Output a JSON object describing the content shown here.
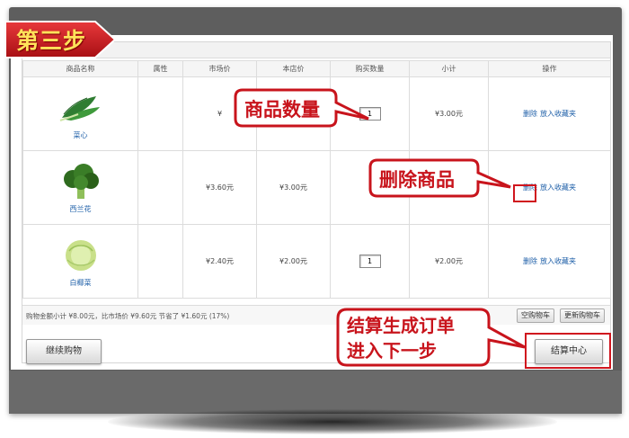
{
  "step_banner": {
    "label": "第三步"
  },
  "table": {
    "headers": [
      "商品名称",
      "属性",
      "市场价",
      "本店价",
      "购买数量",
      "小计",
      "操作"
    ],
    "rows": [
      {
        "name": "菜心",
        "attr": "",
        "market_price": "¥",
        "shop_price": "",
        "qty": "1",
        "subtotal": "¥3.00元",
        "delete": "删除",
        "favorite": "放入收藏夹"
      },
      {
        "name": "西兰花",
        "attr": "",
        "market_price": "¥3.60元",
        "shop_price": "¥3.00元",
        "qty": "",
        "subtotal": "",
        "delete": "删除",
        "favorite": "放入收藏夹"
      },
      {
        "name": "白椰菜",
        "attr": "",
        "market_price": "¥2.40元",
        "shop_price": "¥2.00元",
        "qty": "1",
        "subtotal": "¥2.00元",
        "delete": "删除",
        "favorite": "放入收藏夹"
      }
    ]
  },
  "summary": {
    "text": "购物金额小计 ¥8.00元，比市场价 ¥9.60元 节省了 ¥1.60元 (17%)",
    "clear_cart": "空购物车",
    "update_cart": "更新购物车"
  },
  "actions": {
    "continue_shopping": "继续购物",
    "checkout": "结算中心"
  },
  "callouts": {
    "quantity": "商品数量",
    "delete": "删除商品",
    "checkout_line1": "结算生成订单",
    "checkout_line2": "进入下一步"
  },
  "colors": {
    "accent_red": "#c8141c",
    "banner_red": "#d21f24",
    "link_blue": "#1e5fa8"
  }
}
